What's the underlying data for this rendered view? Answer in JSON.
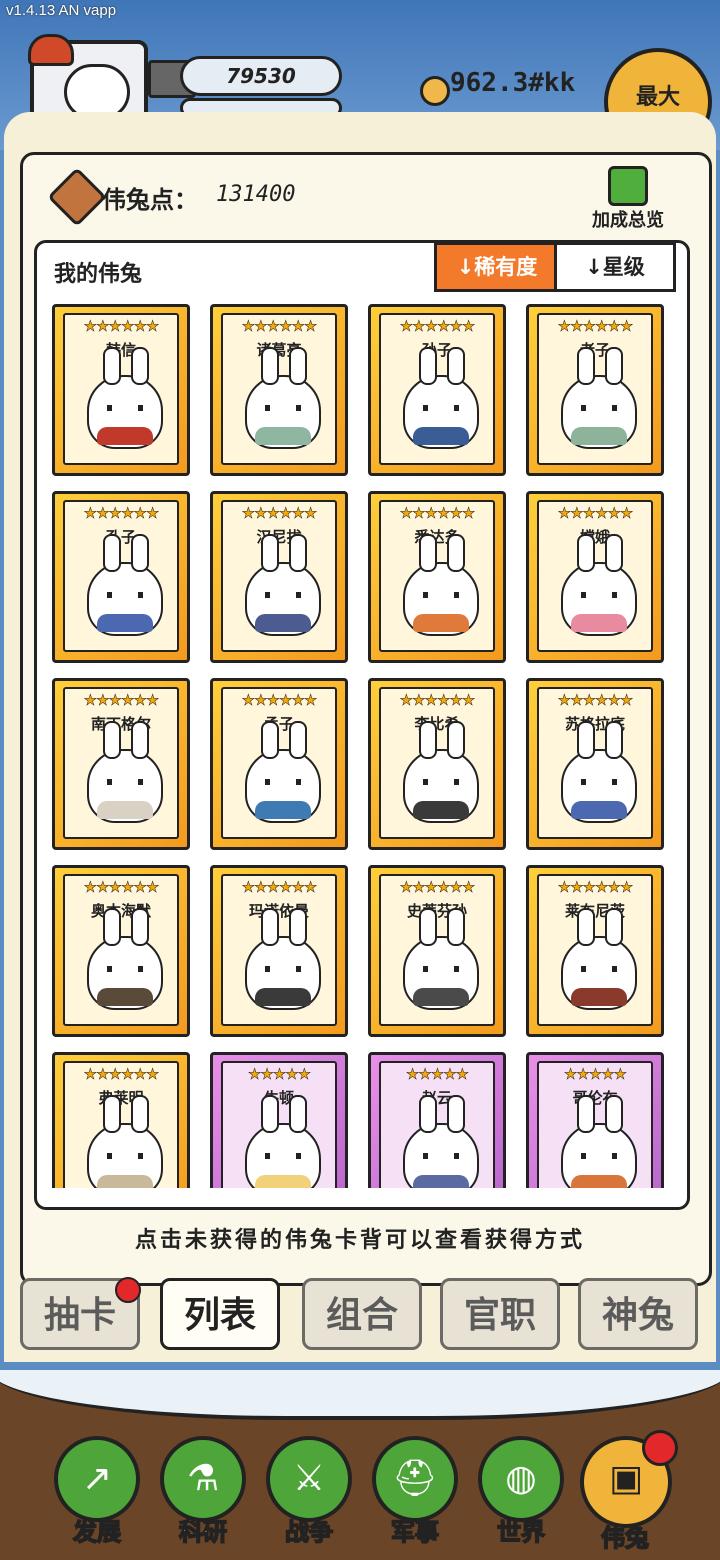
{
  "version": "v1.4.13 AN vapp",
  "header": {
    "bar_value": "79530",
    "coins": "962.3#kk",
    "max_label": "最大"
  },
  "points": {
    "label": "伟兔点：",
    "value": "131400",
    "bonus_label": "加成总览"
  },
  "list": {
    "title": "我的伟兔",
    "sort_rarity": "↓稀有度",
    "sort_star": "↓星级",
    "cards": [
      {
        "name": "韩信",
        "stars": "★★★★★★",
        "color": "#c0392b"
      },
      {
        "name": "诸葛亮",
        "stars": "★★★★★★",
        "color": "#8fb6a0"
      },
      {
        "name": "孙子",
        "stars": "★★★★★★",
        "color": "#3a5d95"
      },
      {
        "name": "老子",
        "stars": "★★★★★★",
        "color": "#8db39b"
      },
      {
        "name": "孔子",
        "stars": "★★★★★★",
        "color": "#4c68b0"
      },
      {
        "name": "汉尼拔",
        "stars": "★★★★★★",
        "color": "#4c5b90"
      },
      {
        "name": "悉达多",
        "stars": "★★★★★★",
        "color": "#e07a3a"
      },
      {
        "name": "嫦娥",
        "stars": "★★★★★★",
        "color": "#e88aa0"
      },
      {
        "name": "南丁格尔",
        "stars": "★★★★★★",
        "color": "#d9d2c4"
      },
      {
        "name": "孟子",
        "stars": "★★★★★★",
        "color": "#3f7bb3"
      },
      {
        "name": "李比希",
        "stars": "★★★★★★",
        "color": "#3a3a3a"
      },
      {
        "name": "苏格拉底",
        "stars": "★★★★★★",
        "color": "#4c68b0"
      },
      {
        "name": "奥本海默",
        "stars": "★★★★★★",
        "color": "#5a4a3a"
      },
      {
        "name": "玛诺依曼",
        "stars": "★★★★★★",
        "color": "#3a3a3a"
      },
      {
        "name": "史蒂芬孙",
        "stars": "★★★★★★",
        "color": "#4a4a4a"
      },
      {
        "name": "莱布尼茨",
        "stars": "★★★★★★",
        "color": "#8a3a2a"
      },
      {
        "name": "弗莱明",
        "stars": "★★★★★★",
        "color": "#c9b89a",
        "purple": false
      },
      {
        "name": "牛顿",
        "stars": "★★★★★",
        "color": "#f1d27a",
        "purple": true
      },
      {
        "name": "赵云",
        "stars": "★★★★★",
        "color": "#5b6aa0",
        "purple": true
      },
      {
        "name": "哥伦布",
        "stars": "★★★★★",
        "color": "#d9743a",
        "purple": true
      }
    ]
  },
  "hint": "点击未获得的伟兔卡背可以查看获得方式",
  "tabs": [
    "抽卡",
    "列表",
    "组合",
    "官职",
    "神兔"
  ],
  "nav": [
    {
      "label": "发展",
      "icon": "chart-up-icon"
    },
    {
      "label": "科研",
      "icon": "flask-icon"
    },
    {
      "label": "战争",
      "icon": "swords-icon"
    },
    {
      "label": "军事",
      "icon": "helmet-icon"
    },
    {
      "label": "世界",
      "icon": "globe-icon"
    },
    {
      "label": "伟兔",
      "icon": "rabbit-card-icon"
    }
  ]
}
